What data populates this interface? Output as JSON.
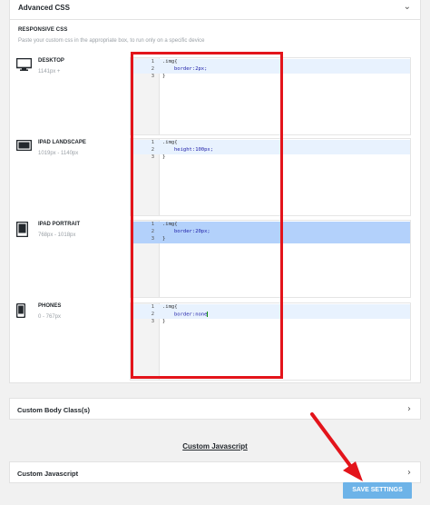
{
  "advanced_css": {
    "title": "Advanced CSS",
    "section_title": "RESPONSIVE CSS",
    "section_desc": "Paste your custom css in the appropriate box, to run only on a specific device",
    "devices": [
      {
        "name": "DESKTOP",
        "range": "1141px +",
        "icon": "desktop-icon",
        "lines": [
          {
            "num": "1",
            "selector": ".img{",
            "prop": "",
            "val": ""
          },
          {
            "num": "2",
            "selector": "",
            "prop": "border:",
            "val": "2px;"
          },
          {
            "num": "3",
            "selector": "}",
            "prop": "",
            "val": ""
          }
        ]
      },
      {
        "name": "IPAD LANDSCAPE",
        "range": "1019px - 1140px",
        "icon": "tablet-landscape-icon",
        "lines": [
          {
            "num": "1",
            "selector": ".img{",
            "prop": "",
            "val": ""
          },
          {
            "num": "2",
            "selector": "",
            "prop": "height:",
            "val": "100px;"
          },
          {
            "num": "3",
            "selector": "}",
            "prop": "",
            "val": ""
          }
        ]
      },
      {
        "name": "IPAD PORTRAIT",
        "range": "768px - 1018px",
        "icon": "tablet-portrait-icon",
        "lines": [
          {
            "num": "1",
            "selector": ".img{",
            "prop": "",
            "val": ""
          },
          {
            "num": "2",
            "selector": "",
            "prop": "border:",
            "val": "20px;"
          },
          {
            "num": "3",
            "selector": "}",
            "prop": "",
            "val": ""
          }
        ]
      },
      {
        "name": "PHONES",
        "range": "0 - 767px",
        "icon": "phone-icon",
        "lines": [
          {
            "num": "1",
            "selector": ".img{",
            "prop": "",
            "val": ""
          },
          {
            "num": "2",
            "selector": "",
            "prop": "border:",
            "val": "none"
          },
          {
            "num": "3",
            "selector": "}",
            "prop": "",
            "val": ""
          }
        ]
      }
    ]
  },
  "custom_body_class": {
    "label": "Custom Body Class(s)"
  },
  "custom_js_heading": "Custom Javascript",
  "custom_js_row": {
    "label": "Custom Javascript"
  },
  "save_button": {
    "label": "SAVE SETTINGS"
  },
  "colors": {
    "highlight_box": "#e3141b",
    "arrow": "#e3141b",
    "save_button": "#6db3e8",
    "selection": "#b3d1fb"
  }
}
